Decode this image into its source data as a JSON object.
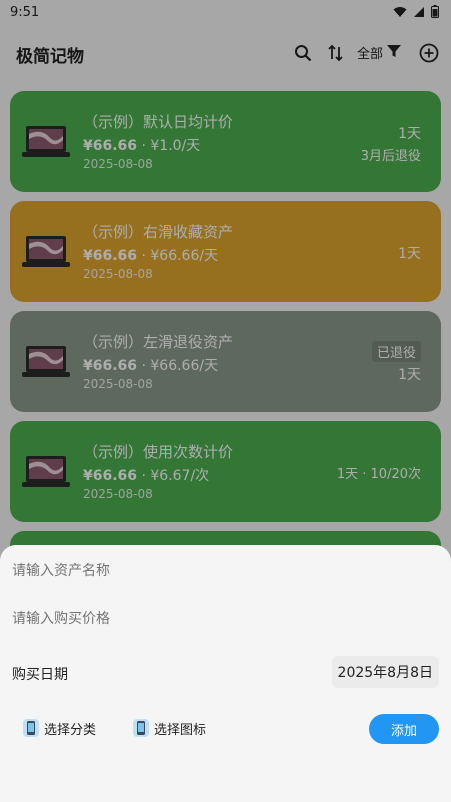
{
  "status_bar": {
    "time": "9:51"
  },
  "app_bar": {
    "title": "极简记物",
    "filter_label": "全部"
  },
  "cards": [
    {
      "name": "（示例）默认日均计价",
      "price": "¥66.66",
      "rate": "· ¥1.0/天",
      "date": "2025-08-08",
      "right_top": "1天",
      "right_bottom": "3月后退役",
      "badge": ""
    },
    {
      "name": "（示例）右滑收藏资产",
      "price": "¥66.66",
      "rate": "· ¥66.66/天",
      "date": "2025-08-08",
      "right_top": "1天",
      "right_bottom": "",
      "badge": ""
    },
    {
      "name": "（示例）左滑退役资产",
      "price": "¥66.66",
      "rate": "· ¥66.66/天",
      "date": "2025-08-08",
      "right_top": "1天",
      "right_bottom": "",
      "badge": "已退役"
    },
    {
      "name": "（示例）使用次数计价",
      "price": "¥66.66",
      "rate": "· ¥6.67/次",
      "date": "2025-08-08",
      "right_top": "1天 · 10/20次",
      "right_bottom": "",
      "badge": ""
    }
  ],
  "sheet": {
    "name_placeholder": "请输入资产名称",
    "price_placeholder": "请输入购买价格",
    "date_label": "购买日期",
    "date_value": "2025年8月8日",
    "category_label": "选择分类",
    "icon_label": "选择图标",
    "add_label": "添加"
  },
  "colors": {
    "green": "#4caf50",
    "orange": "#dda62f",
    "gray": "#8c9a8c",
    "accent": "#2196f3"
  },
  "icons": [
    "search-icon",
    "sort-icon",
    "filter-icon",
    "add-circle-icon",
    "laptop-icon",
    "phone-icon",
    "wifi-icon",
    "signal-icon",
    "battery-icon"
  ]
}
